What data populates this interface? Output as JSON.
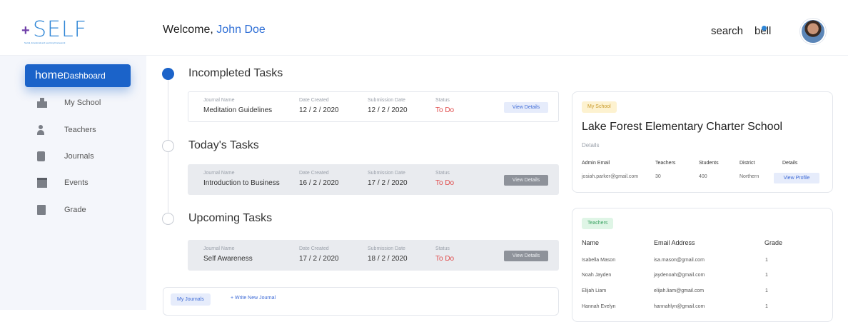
{
  "header": {
    "logo": {
      "plus": "+",
      "word": "SELF",
      "tagline": "Social, Emotional and Learning Framework"
    },
    "welcome_prefix": "Welcome,",
    "user_name": "John Doe",
    "search_label": "search",
    "bell_label": "bell"
  },
  "sidebar": {
    "active": {
      "icon_text": "home",
      "label": "Dashboard"
    },
    "items": [
      {
        "label": "My School",
        "icon": "school-icon"
      },
      {
        "label": "Teachers",
        "icon": "teacher-icon"
      },
      {
        "label": "Journals",
        "icon": "journal-icon"
      },
      {
        "label": "Events",
        "icon": "calendar-icon"
      },
      {
        "label": "Grade",
        "icon": "clipboard-icon"
      }
    ]
  },
  "tasks": {
    "columns": [
      "Journal Name",
      "Date Created",
      "Submission Date",
      "Status"
    ],
    "sections": [
      {
        "title": "Incompleted Tasks",
        "row": {
          "name": "Meditation Guidelines",
          "created": "12 / 2 / 2020",
          "submission": "12 / 2 / 2020",
          "status": "To Do",
          "button": "View Details"
        }
      },
      {
        "title": "Today's Tasks",
        "row": {
          "name": "Introduction to Business",
          "created": "16 / 2 / 2020",
          "submission": "17 / 2 / 2020",
          "status": "To Do",
          "button": "View Details"
        }
      },
      {
        "title": "Upcoming Tasks",
        "row": {
          "name": "Self Awareness",
          "created": "17 / 2 / 2020",
          "submission": "18 / 2 / 2020",
          "status": "To Do",
          "button": "View Details"
        }
      }
    ]
  },
  "journals": {
    "tab": "My Journals",
    "new": "+ Write New Journal"
  },
  "school_card": {
    "badge": "My School",
    "name": "Lake Forest Elementary Charter School",
    "details_label": "Details",
    "headers": [
      "Admin Email",
      "Teachers",
      "Students",
      "District",
      "Details"
    ],
    "values": {
      "email": "josiah.parker@gmail.com",
      "teachers": "30",
      "students": "400",
      "district": "Northern"
    },
    "profile_button": "View Profile"
  },
  "teachers_card": {
    "badge": "Teachers",
    "headers": [
      "Name",
      "Email Address",
      "Grade"
    ],
    "rows": [
      {
        "name": "Isabella Mason",
        "email": "isa.mason@gmail.com",
        "grade": "1"
      },
      {
        "name": "Noah Jayden",
        "email": "jaydenoah@gmail.com",
        "grade": "1"
      },
      {
        "name": "Elijah Liam",
        "email": "elijah.liam@gmail.com",
        "grade": "1"
      },
      {
        "name": "Hannah Evelyn",
        "email": "hannahlyn@gmail.com",
        "grade": "1"
      }
    ]
  },
  "colors": {
    "primary": "#1b63c9",
    "todo": "#e04a4a",
    "logo_blue": "#2f86d6",
    "logo_purple": "#6f3fa8"
  }
}
